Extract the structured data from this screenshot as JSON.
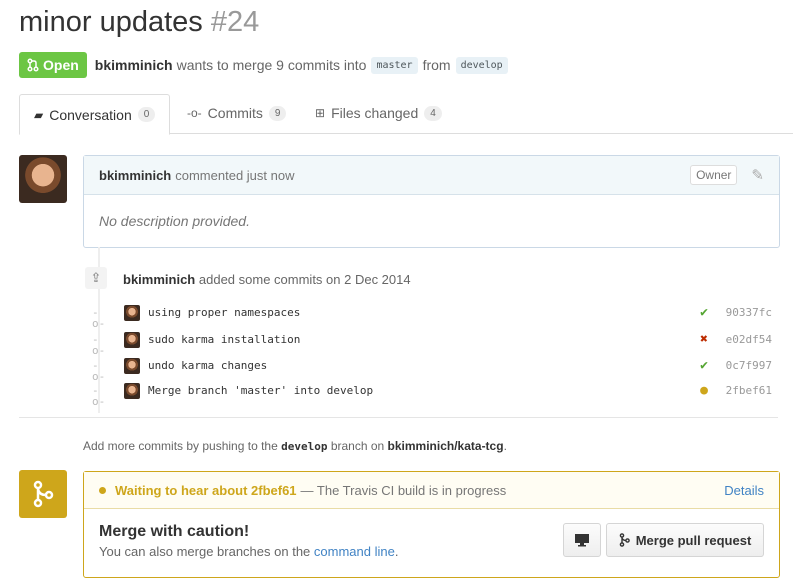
{
  "pr": {
    "title": "minor updates",
    "number": "#24"
  },
  "meta": {
    "state": "Open",
    "author": "bkimminich",
    "text1": "wants to merge 9 commits into",
    "base_branch": "master",
    "text2": "from",
    "head_branch": "develop"
  },
  "tabs": [
    {
      "label": "Conversation",
      "count": "0",
      "icon": "comment-icon"
    },
    {
      "label": "Commits",
      "count": "9",
      "icon": "commit-icon"
    },
    {
      "label": "Files changed",
      "count": "4",
      "icon": "file-diff-icon"
    }
  ],
  "comment": {
    "author": "bkimminich",
    "action": "commented just now",
    "badge": "Owner",
    "body": "No description provided."
  },
  "event": {
    "author": "bkimminich",
    "text": "added some commits on 2 Dec 2014"
  },
  "commits": [
    {
      "message": "using proper namespaces",
      "status": "✔",
      "status_color": "#55a532",
      "sha": "90337fc"
    },
    {
      "message": "sudo karma installation",
      "status": "✖",
      "status_color": "#bd2c00",
      "sha": "e02df54"
    },
    {
      "message": "undo karma changes",
      "status": "✔",
      "status_color": "#55a532",
      "sha": "0c7f997"
    },
    {
      "message": "Merge branch 'master' into develop",
      "status": "●",
      "status_color": "#cea61b",
      "sha": "2fbef61"
    }
  ],
  "hint": {
    "prefix": "Add more commits by pushing to the",
    "branch": "develop",
    "middle": "branch on",
    "repo": "bkimminich/kata-tcg",
    "suffix": "."
  },
  "merge": {
    "status_bold": "Waiting to hear about 2fbef61",
    "status_text": "— The Travis CI build is in progress",
    "details": "Details",
    "heading": "Merge with caution!",
    "sub_text": "You can also merge branches on the",
    "sub_link": "command line",
    "sub_end": ".",
    "button": "Merge pull request"
  },
  "colors": {
    "open": "#6cc644",
    "pending": "#cea61b",
    "link": "#4183c4"
  }
}
